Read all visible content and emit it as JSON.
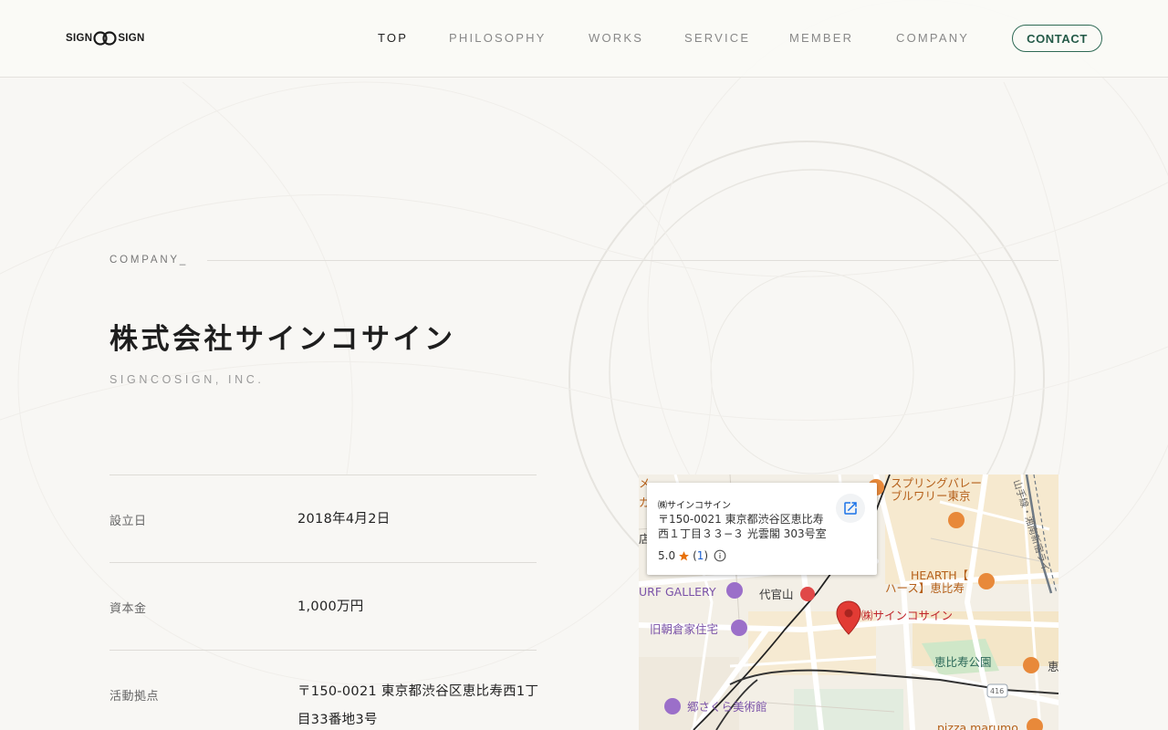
{
  "header": {
    "logo_left": "SIGN",
    "logo_right": "SIGN",
    "nav": [
      {
        "label": "TOP",
        "active": true
      },
      {
        "label": "PHILOSOPHY",
        "active": false
      },
      {
        "label": "WORKS",
        "active": false
      },
      {
        "label": "SERVICE",
        "active": false
      },
      {
        "label": "MEMBER",
        "active": false
      },
      {
        "label": "COMPANY",
        "active": false
      }
    ],
    "contact_label": "CONTACT",
    "accent_color": "#2e6a55"
  },
  "company": {
    "section_label": "COMPANY_",
    "name_ja": "株式会社サインコサイン",
    "name_en": "SIGNCOSIGN, INC.",
    "info": [
      {
        "key": "設立日",
        "value": "2018年4月2日"
      },
      {
        "key": "資本金",
        "value": "1,000万円"
      },
      {
        "key": "活動拠点",
        "value": "〒150-0021 東京都渋谷区恵比寿西1丁目33番地3号"
      }
    ]
  },
  "map": {
    "card": {
      "place_name": "㈱サインコサイン",
      "address": "〒150-0021 東京都渋谷区恵比寿西１丁目３３−３ 光雲閣 303号室",
      "rating": "5.0",
      "review_count_open": "(",
      "review_count": "1",
      "review_count_close": ")"
    },
    "labels": {
      "spring_valley_1": "スプリングバレー",
      "spring_valley_2": "ブルワリー東京",
      "hearth_1": "HEARTH【",
      "hearth_2": "ハース】恵比寿",
      "daikanyama": "代官山",
      "marker_name": "㈱サインコサイン",
      "turf_gallery": "URF GALLERY",
      "asakura": "旧朝倉家住宅",
      "ebisu_park": "恵比寿公園",
      "sato_sakura": "郷さくら美術館",
      "pizza": "pizza marumo",
      "ebisu_edge": "恵",
      "road_416": "416",
      "line_yamanote": "山手線・湘南新宿ライ",
      "left_edge_1": "メ",
      "left_edge_2": "ガ",
      "left_edge_3": "店"
    },
    "icons": [
      "external-link-icon",
      "star-icon",
      "info-icon",
      "map-pin-icon"
    ]
  }
}
